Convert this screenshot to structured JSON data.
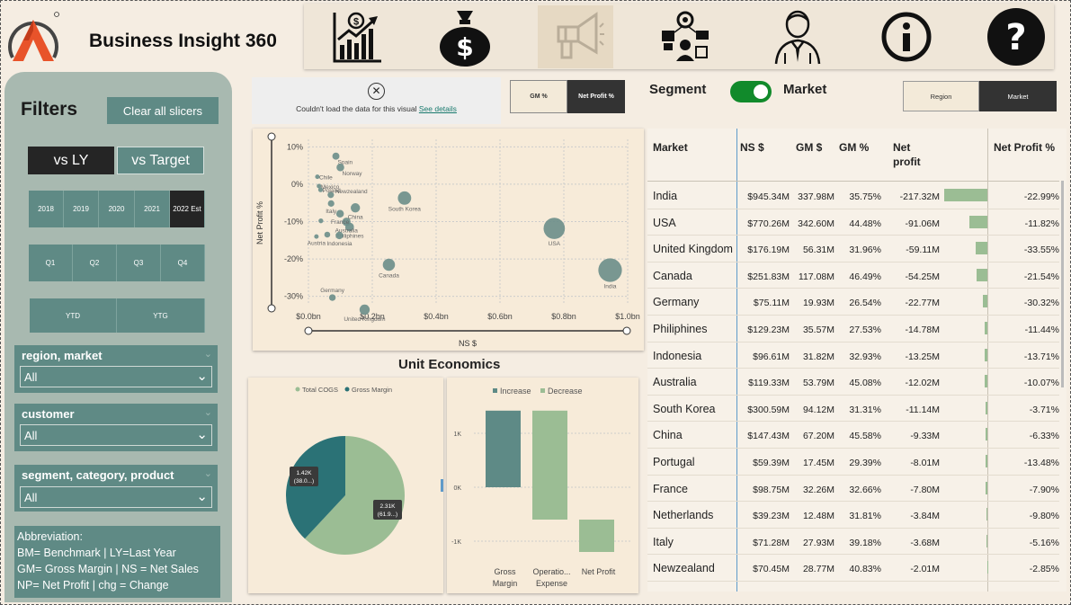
{
  "app": {
    "title": "Business Insight 360"
  },
  "nav": [
    "chart-growth-icon",
    "money-bag-icon",
    "megaphone-icon",
    "supply-chain-icon",
    "executive-icon",
    "info-icon",
    "help-icon"
  ],
  "filters": {
    "title": "Filters",
    "clear_label": "Clear all slicers",
    "compare": [
      "vs LY",
      "vs Target"
    ],
    "years": [
      "2018",
      "2019",
      "2020",
      "2021",
      "2022 Est"
    ],
    "quarters": [
      "Q1",
      "Q2",
      "Q3",
      "Q4"
    ],
    "ytd": [
      "YTD",
      "YTG"
    ],
    "slicers": [
      {
        "title": "region, market",
        "value": "All"
      },
      {
        "title": "customer",
        "value": "All"
      },
      {
        "title": "segment, category, product",
        "value": "All"
      }
    ],
    "abbreviation": {
      "title": "Abbreviation:",
      "lines": [
        "BM= Benchmark | LY=Last Year",
        "GM= Gross Margin | NS = Net Sales",
        "NP= Net Profit | chg = Change"
      ]
    }
  },
  "error_visual": {
    "message": "Couldn't load the data for this visual",
    "link": "See details"
  },
  "gm_toggle": [
    "GM %",
    "Net Profit %"
  ],
  "segment_switch": {
    "left": "Segment",
    "right": "Market"
  },
  "region_market": [
    "Region",
    "Market"
  ],
  "colors": {
    "accent": "#5f8a85",
    "dark": "#252525",
    "bar": "#9bbd94",
    "pie_cogs": "#9bbd94",
    "pie_gm": "#2b7276",
    "switch_on": "#118a2b"
  },
  "chart_data": [
    {
      "type": "scatter",
      "xlabel": "NS $",
      "ylabel": "Net Profit %",
      "xlim": [
        0,
        1.0
      ],
      "ylim": [
        -0.32,
        0.12
      ],
      "x_ticks": [
        "$0.0bn",
        "$0.2bn",
        "$0.4bn",
        "$0.6bn",
        "$0.8bn",
        "$1.0bn"
      ],
      "y_ticks": [
        "10%",
        "0%",
        "-10%",
        "-20%",
        "-30%"
      ],
      "points": [
        {
          "label": "India",
          "x": 0.945,
          "y": -0.2299
        },
        {
          "label": "USA",
          "x": 0.77,
          "y": -0.1182
        },
        {
          "label": "South Korea",
          "x": 0.301,
          "y": -0.0371
        },
        {
          "label": "Canada",
          "x": 0.252,
          "y": -0.2154
        },
        {
          "label": "United Kingdom",
          "x": 0.176,
          "y": -0.3355
        },
        {
          "label": "Philiphines",
          "x": 0.129,
          "y": -0.1144
        },
        {
          "label": "Australia",
          "x": 0.119,
          "y": -0.1007
        },
        {
          "label": "China",
          "x": 0.147,
          "y": -0.0633
        },
        {
          "label": "Indonesia",
          "x": 0.097,
          "y": -0.1371
        },
        {
          "label": "France",
          "x": 0.099,
          "y": -0.079
        },
        {
          "label": "Germany",
          "x": 0.075,
          "y": -0.3032
        },
        {
          "label": "Italy",
          "x": 0.071,
          "y": -0.0516
        },
        {
          "label": "Newzealand",
          "x": 0.07,
          "y": -0.0285
        },
        {
          "label": "Spain",
          "x": 0.086,
          "y": 0.075
        },
        {
          "label": "Norway",
          "x": 0.1,
          "y": 0.045
        },
        {
          "label": "Chile",
          "x": 0.028,
          "y": 0.02
        },
        {
          "label": "Mexico",
          "x": 0.033,
          "y": -0.005
        },
        {
          "label": "Poland",
          "x": 0.038,
          "y": -0.015
        },
        {
          "label": "Portugal",
          "x": 0.059,
          "y": -0.1348
        },
        {
          "label": "Netherlands",
          "x": 0.039,
          "y": -0.098
        },
        {
          "label": "Austria",
          "x": 0.025,
          "y": -0.14
        }
      ]
    },
    {
      "type": "pie",
      "legend": [
        "Total COGS",
        "Gross Margin"
      ],
      "slices": [
        {
          "name": "Total COGS",
          "value": 2.31,
          "label": "2.31K",
          "sub": "(61.9...)"
        },
        {
          "name": "Gross Margin",
          "value": 1.42,
          "label": "1.42K",
          "sub": "(38.0...)"
        }
      ]
    },
    {
      "type": "bar",
      "subtype": "waterfall",
      "legend": [
        "Increase",
        "Decrease"
      ],
      "categories": [
        "Gross Margin",
        "Operatio... Expense",
        "Net Profit"
      ],
      "category_lines": [
        [
          "Gross",
          "Margin"
        ],
        [
          "Operatio...",
          "Expense"
        ],
        [
          "Net Profit"
        ]
      ],
      "values": [
        1420,
        -2020,
        -600
      ],
      "y_ticks": [
        "1K",
        "0K",
        "-1K"
      ],
      "ylim": [
        -1300,
        1600
      ]
    },
    {
      "type": "table",
      "columns": [
        "Market",
        "NS $",
        "GM $",
        "GM %",
        "Net profit",
        "Net Profit %"
      ],
      "rows": [
        [
          "India",
          "$945.34M",
          "337.98M",
          "35.75%",
          "-217.32M",
          "-22.99%"
        ],
        [
          "USA",
          "$770.26M",
          "342.60M",
          "44.48%",
          "-91.06M",
          "-11.82%"
        ],
        [
          "United Kingdom",
          "$176.19M",
          "56.31M",
          "31.96%",
          "-59.11M",
          "-33.55%"
        ],
        [
          "Canada",
          "$251.83M",
          "117.08M",
          "46.49%",
          "-54.25M",
          "-21.54%"
        ],
        [
          "Germany",
          "$75.11M",
          "19.93M",
          "26.54%",
          "-22.77M",
          "-30.32%"
        ],
        [
          "Philiphines",
          "$129.23M",
          "35.57M",
          "27.53%",
          "-14.78M",
          "-11.44%"
        ],
        [
          "Indonesia",
          "$96.61M",
          "31.82M",
          "32.93%",
          "-13.25M",
          "-13.71%"
        ],
        [
          "Australia",
          "$119.33M",
          "53.79M",
          "45.08%",
          "-12.02M",
          "-10.07%"
        ],
        [
          "South Korea",
          "$300.59M",
          "94.12M",
          "31.31%",
          "-11.14M",
          "-3.71%"
        ],
        [
          "China",
          "$147.43M",
          "67.20M",
          "45.58%",
          "-9.33M",
          "-6.33%"
        ],
        [
          "Portugal",
          "$59.39M",
          "17.45M",
          "29.39%",
          "-8.01M",
          "-13.48%"
        ],
        [
          "France",
          "$98.75M",
          "32.26M",
          "32.66%",
          "-7.80M",
          "-7.90%"
        ],
        [
          "Netherlands",
          "$39.23M",
          "12.48M",
          "31.81%",
          "-3.84M",
          "-9.80%"
        ],
        [
          "Italy",
          "$71.28M",
          "27.93M",
          "39.18%",
          "-3.68M",
          "-5.16%"
        ],
        [
          "Newzealand",
          "$70.45M",
          "28.77M",
          "40.83%",
          "-2.01M",
          "-2.85%"
        ]
      ],
      "net_profit_values": [
        -217.32,
        -91.06,
        -59.11,
        -54.25,
        -22.77,
        -14.78,
        -13.25,
        -12.02,
        -11.14,
        -9.33,
        -8.01,
        -7.8,
        -3.84,
        -3.68,
        -2.01
      ]
    }
  ]
}
